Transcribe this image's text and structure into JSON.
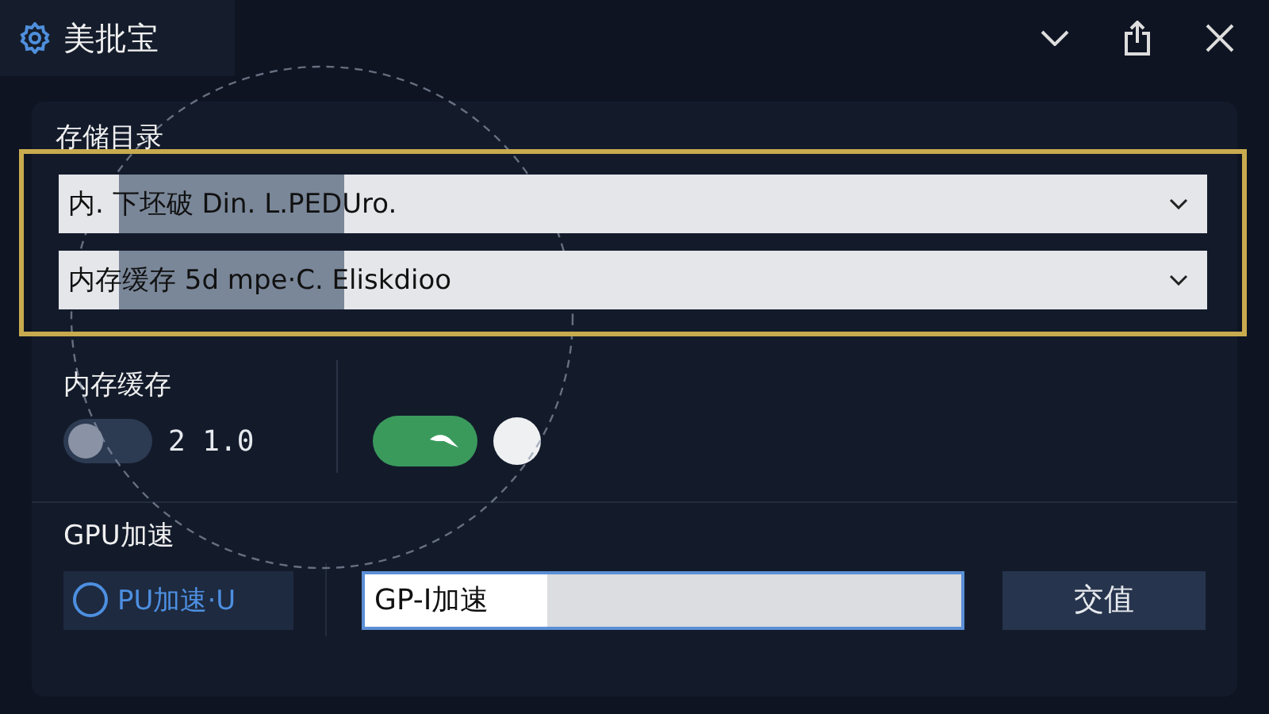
{
  "window": {
    "title": "美批宝"
  },
  "storage": {
    "label": "存储目录",
    "dropdowns": [
      {
        "value": "内. 下坯破 Din. L.PEDUro."
      },
      {
        "value": "内存缓存 5d mpe·C. Eliskdioo"
      }
    ]
  },
  "memory": {
    "label": "内存缓存",
    "toggle": {
      "on": false
    },
    "reading": "2 1.0",
    "switch": {
      "on": true
    }
  },
  "gpu": {
    "label": "GPU加速",
    "radio": {
      "label": "PU加速·U",
      "selected": false
    },
    "input": {
      "value": "GP-I加速"
    },
    "button": "交值"
  }
}
